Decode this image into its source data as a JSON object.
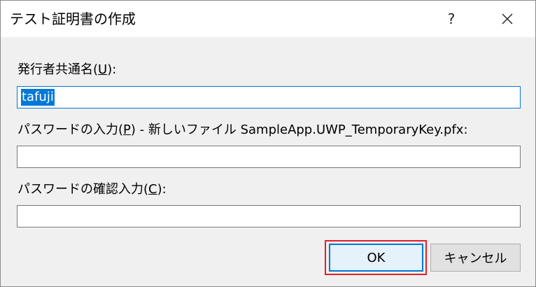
{
  "window": {
    "title": "テスト証明書の作成",
    "help_label": "?",
    "close_icon": "close-icon"
  },
  "common_name": {
    "label_prefix": "発行者共通名(",
    "label_accel": "U",
    "label_suffix": "):",
    "value": "tafuji"
  },
  "password": {
    "label_prefix": "パスワードの入力(",
    "label_accel": "P",
    "label_suffix": ") - 新しいファイル SampleApp.UWP_TemporaryKey.pfx:",
    "value": ""
  },
  "confirm_password": {
    "label_prefix": "パスワードの確認入力(",
    "label_accel": "C",
    "label_suffix": "):",
    "value": ""
  },
  "buttons": {
    "ok_label": "OK",
    "cancel_label": "キャンセル"
  },
  "colors": {
    "accent": "#0078d7",
    "highlight_box": "#e0202a",
    "dialog_bg": "#f0f0f0"
  }
}
